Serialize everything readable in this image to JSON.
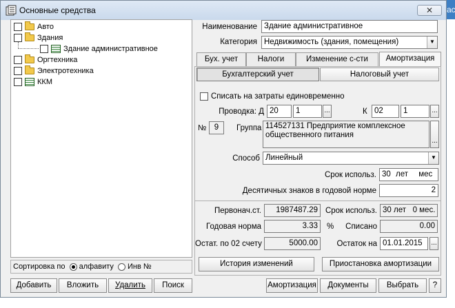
{
  "window": {
    "title": "Основные средства",
    "close_label": "✕"
  },
  "edge_tab": {
    "label": "ас"
  },
  "tree": {
    "items": [
      {
        "label": "Авто"
      },
      {
        "label": "Здания"
      },
      {
        "label": "Здание административное"
      },
      {
        "label": "Оргтехника"
      },
      {
        "label": "Электротехника"
      },
      {
        "label": "ККМ"
      }
    ]
  },
  "sort": {
    "label": "Сортировка по",
    "opt1": "алфавиту",
    "opt2": "Инв №",
    "selected": "алфавиту"
  },
  "left_buttons": {
    "add": "Добавить",
    "insert": "Вложить",
    "delete": "Удалить",
    "search": "Поиск"
  },
  "form": {
    "name_label": "Наименование",
    "name_value": "Здание административное",
    "category_label": "Категория",
    "category_value": "Недвижимость (здания, помещения)"
  },
  "tabs": [
    {
      "label": "Бух. учет"
    },
    {
      "label": "Налоги"
    },
    {
      "label": "Изменение с-сти"
    },
    {
      "label": "Амортизация"
    }
  ],
  "subtabs": {
    "accounting": "Бухгалтерский учет",
    "tax": "Налоговый учет"
  },
  "amort": {
    "writeoff_label": "Списать на затраты единовременно",
    "posting_label": "Проводка: Д",
    "debit_account": "20",
    "debit_sub": "1",
    "credit_label": "К",
    "credit_account": "02",
    "credit_sub": "1",
    "num_label": "№",
    "num_value": "9",
    "group_label": "Группа",
    "group_value": "114527131 Предприятие комплексное общественного питания",
    "method_label": "Способ",
    "method_value": "Линейный",
    "term_label": "Срок использ.",
    "term_years": "30",
    "term_years_unit": "лет",
    "term_months_unit": "мес",
    "decimals_label": "Десятичных знаков в годовой норме",
    "decimals_value": "2"
  },
  "summary": {
    "initial_cost_label": "Первонач.ст.",
    "initial_cost": "1987487.29",
    "term_label": "Срок использ.",
    "term_value": "30 лет   0 мес.",
    "annual_rate_label": "Годовая норма",
    "annual_rate": "3.33",
    "percent_sign": "%",
    "written_off_label": "Списано",
    "written_off": "0.00",
    "residual_02_label": "Остат. по 02 счету",
    "residual_02": "5000.00",
    "balance_on_label": "Остаток на",
    "balance_on_date": "01.01.2015"
  },
  "history_button": "История изменений",
  "suspend_button": "Приостановка амортизации",
  "bottom_buttons": {
    "amortization": "Амортизация",
    "documents": "Документы",
    "select": "Выбрать",
    "help": "?"
  },
  "ellipsis": "..."
}
